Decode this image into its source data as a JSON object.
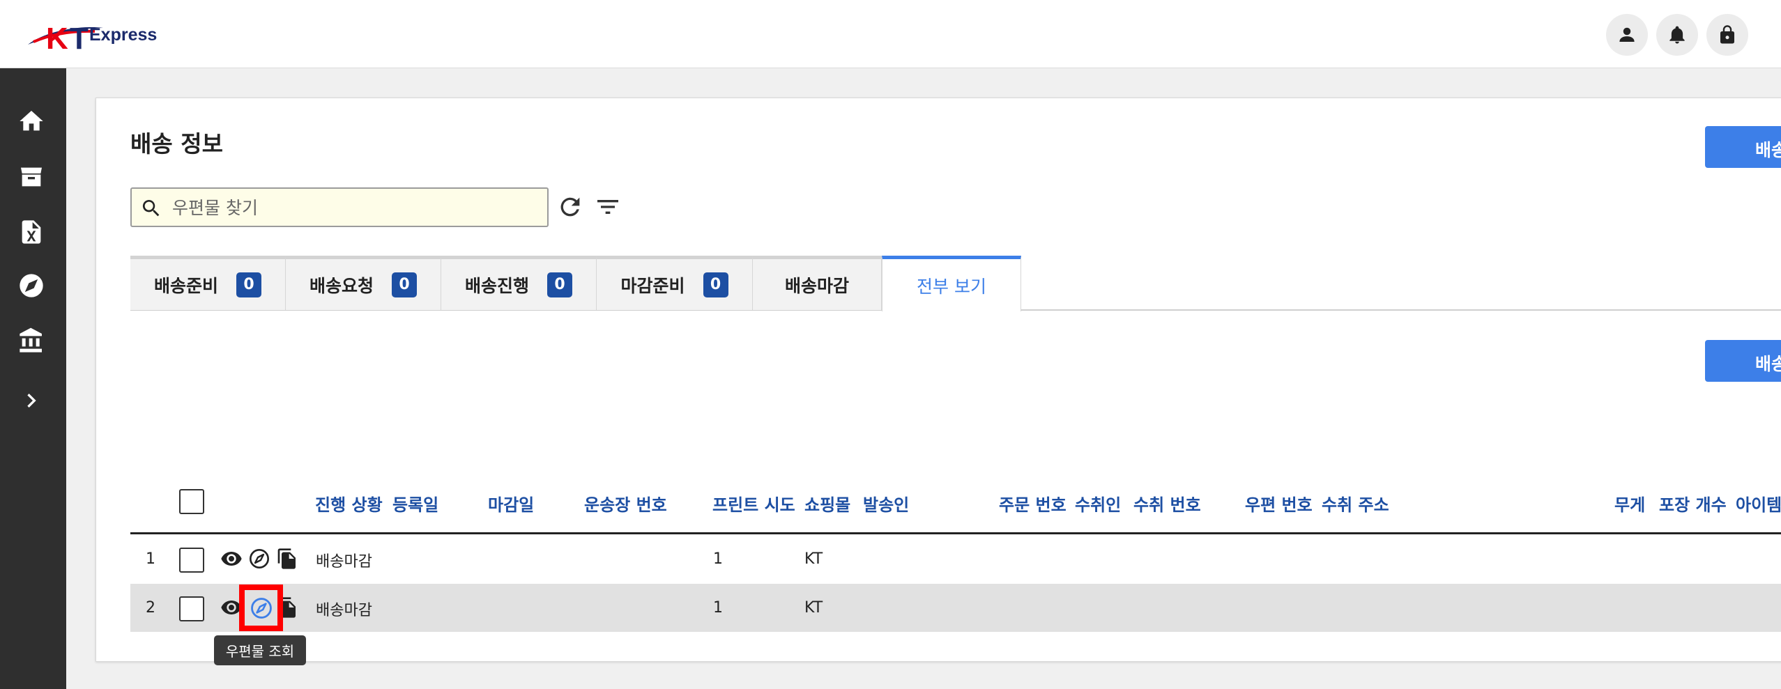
{
  "header": {
    "logo_text": "Express",
    "profile_icon": "person-icon",
    "notification_icon": "bell-icon",
    "lock_icon": "lock-icon"
  },
  "sidebar": {
    "items": [
      {
        "icon": "home-icon"
      },
      {
        "icon": "box-icon"
      },
      {
        "icon": "excel-icon"
      },
      {
        "icon": "compass-icon"
      },
      {
        "icon": "bank-icon"
      },
      {
        "icon": "chevron-right-icon"
      }
    ]
  },
  "main": {
    "title": "배송 정보",
    "search": {
      "placeholder": "우편물 찾기",
      "value": ""
    },
    "top_button_label": "배송",
    "second_button_label": "배송",
    "tabs": [
      {
        "label": "배송준비",
        "count": "0"
      },
      {
        "label": "배송요청",
        "count": "0"
      },
      {
        "label": "배송진행",
        "count": "0"
      },
      {
        "label": "마감준비",
        "count": "0"
      },
      {
        "label": "배송마감"
      },
      {
        "label": "전부 보기",
        "active": true
      }
    ],
    "table": {
      "columns": [
        "진행 상황",
        "등록일",
        "마감일",
        "운송장 번호",
        "프린트 시도",
        "쇼핑몰",
        "발송인",
        "주문 번호",
        "수취인",
        "수취 번호",
        "우편 번호",
        "수취 주소",
        "무게",
        "포장 개수",
        "아이템"
      ],
      "rows": [
        {
          "index": "1",
          "status": "배송마감",
          "print_tries": "1",
          "mall": "KT"
        },
        {
          "index": "2",
          "status": "배송마감",
          "print_tries": "1",
          "mall": "KT"
        }
      ]
    },
    "tooltip": "우편물 조회"
  },
  "colors": {
    "accent": "#3d7fe8",
    "header_text": "#1d4fa3",
    "sidebar_bg": "#2f2f2f",
    "highlight": "#ff0000"
  }
}
